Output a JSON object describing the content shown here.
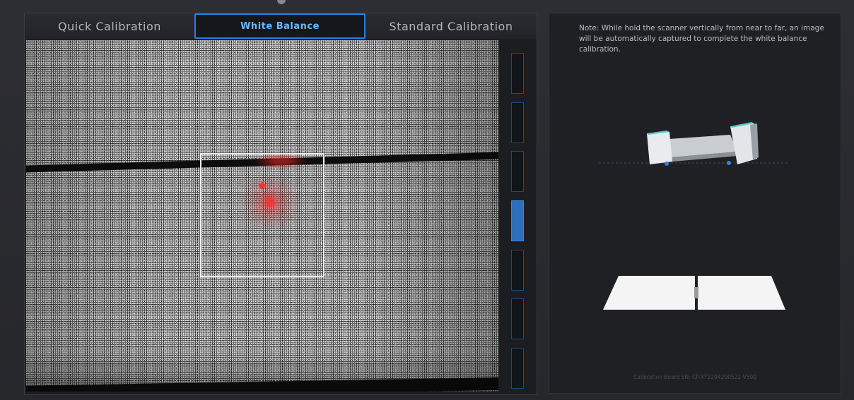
{
  "tabs": {
    "quick": "Quick Calibration",
    "white_balance": "White Balance",
    "standard": "Standard Calibration",
    "active": "white_balance"
  },
  "distance_meter": {
    "segments": 7,
    "active_index": 3
  },
  "info_panel": {
    "note": "Note: While hold the scanner vertically from near to far, an image will be automatically captured to complete the white balance calibration.",
    "board_sn": "Calibration Board SN: CP-XT2204200522-V500"
  },
  "colors": {
    "accent": "#1e82e6",
    "active_tab_text": "#6db7ff",
    "meter_active": "#2c6fbf",
    "marker": "#ff3030",
    "background": "#2a2b2f"
  }
}
